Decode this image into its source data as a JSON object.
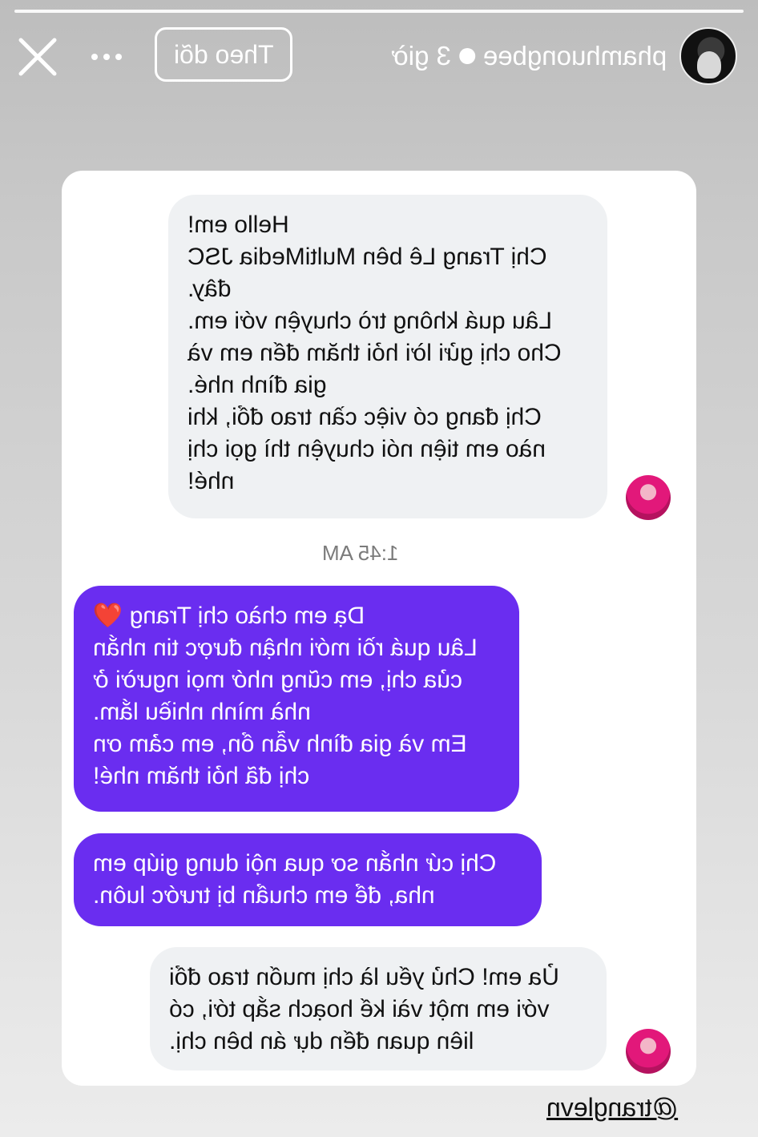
{
  "story_header": {
    "username": "phamhuongbee",
    "time_ago": "3 giờ",
    "follow_label": "Theo dõi",
    "more_icon": "ellipsis-icon",
    "close_icon": "close-icon"
  },
  "conversation": {
    "messages": [
      {
        "direction": "incoming",
        "lines": [
          "Hello em!",
          "Chị Trang Lê bên MultiMedia JSC",
          "đây.",
          "Lâu quá không trò chuyện với em.",
          "Cho chị gửi lời hỏi thăm đến em và",
          "gia đình nhé.",
          "Chị đang có việc cần trao đổi, khi",
          "nào em tiện nói chuyện thì gọi chị",
          "nhé!"
        ]
      },
      {
        "direction": "outgoing",
        "lines": [
          "Dạ em chào chị Trang ❤️",
          "Lâu quá rồi mới nhận được tin nhắn",
          "của chị, em cũng nhớ mọi người ở",
          "nhà mình nhiều lắm.",
          "Em và gia đình vẫn ổn, em cảm ơn",
          "chị đã hỏi thăm nhé!"
        ]
      },
      {
        "direction": "outgoing",
        "lines": [
          "Chị cứ nhắn sơ qua nội dung giúp em",
          "nha, để em chuẩn bị trước luôn."
        ]
      },
      {
        "direction": "incoming",
        "lines": [
          "Ủa em! Chủ yếu là chị muốn trao đổi",
          "với em một vài kế hoạch sắp tới, có",
          "liên quan đến dự án bên chị."
        ]
      }
    ],
    "timestamp": "1:45 AM"
  },
  "mention": "@tranglevn",
  "colors": {
    "outgoing_bubble": "#6a2df0",
    "incoming_bubble": "#eff1f3"
  }
}
